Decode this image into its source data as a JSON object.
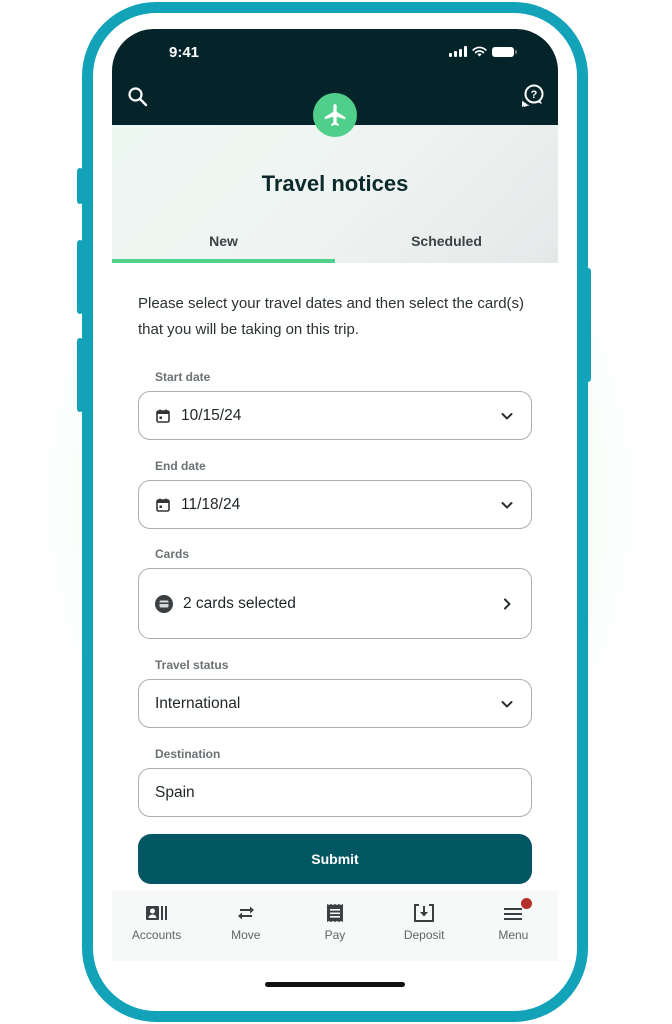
{
  "status_bar": {
    "time": "9:41"
  },
  "header": {
    "title": "Travel notices",
    "icon": "airplane-icon",
    "accent_color": "#4fcf8a"
  },
  "tabs": [
    {
      "label": "New",
      "active": true
    },
    {
      "label": "Scheduled",
      "active": false
    }
  ],
  "form": {
    "intro": "Please select your travel dates and then select the card(s) that you will be taking on this trip.",
    "start_date": {
      "label": "Start date",
      "value": "10/15/24",
      "icon": "calendar-icon"
    },
    "end_date": {
      "label": "End date",
      "value": "11/18/24",
      "icon": "calendar-icon"
    },
    "cards": {
      "label": "Cards",
      "value": "2 cards selected",
      "icon": "card-icon"
    },
    "travel_status": {
      "label": "Travel status",
      "value": "International"
    },
    "destination": {
      "label": "Destination",
      "value": "Spain"
    },
    "submit_label": "Submit",
    "submit_color": "#035762"
  },
  "bottom_nav": [
    {
      "label": "Accounts",
      "icon": "accounts-icon"
    },
    {
      "label": "Move",
      "icon": "transfer-icon"
    },
    {
      "label": "Pay",
      "icon": "bill-icon"
    },
    {
      "label": "Deposit",
      "icon": "deposit-icon"
    },
    {
      "label": "Menu",
      "icon": "menu-icon",
      "has_notification": true
    }
  ]
}
